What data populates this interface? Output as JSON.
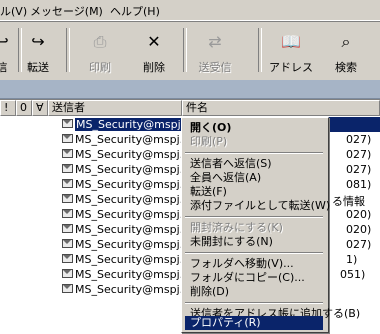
{
  "menubar": {
    "items": [
      "ル(V)",
      "メッセージ(M)",
      "ヘルプ(H)"
    ]
  },
  "toolbar": {
    "buttons": [
      {
        "label": "信",
        "icon": "reply-icon",
        "enabled": true
      },
      {
        "label": "転送",
        "icon": "forward-icon",
        "enabled": true
      },
      {
        "label": "印刷",
        "icon": "print-icon",
        "enabled": false
      },
      {
        "label": "削除",
        "icon": "delete-icon",
        "enabled": true
      },
      {
        "label": "送受信",
        "icon": "send-receive-icon",
        "enabled": false
      },
      {
        "label": "アドレス",
        "icon": "address-book-icon",
        "enabled": true
      },
      {
        "label": "検索",
        "icon": "find-icon",
        "enabled": true
      }
    ]
  },
  "list": {
    "columns": [
      "!",
      "0",
      "∀",
      "送信者",
      "件名"
    ],
    "rows": [
      {
        "sender": "MS_Security@mspj.co.jp",
        "subject_tail": "",
        "selected": true
      },
      {
        "sender": "MS_Security@mspj.co.jp",
        "subject_tail": "027)",
        "selected": false
      },
      {
        "sender": "MS_Security@mspj.co.jp",
        "subject_tail": "027)",
        "selected": false
      },
      {
        "sender": "MS_Security@mspj.co.jp",
        "subject_tail": "027)",
        "selected": false
      },
      {
        "sender": "MS_Security@mspj.co.jp",
        "subject_tail": "081)",
        "selected": false
      },
      {
        "sender": "MS_Security@mspj.co.jp",
        "subject_tail": "る情報",
        "selected": false
      },
      {
        "sender": "MS_Security@mspj.co.jp",
        "subject_tail": "020)",
        "selected": false
      },
      {
        "sender": "MS_Security@mspj.co.jp",
        "subject_tail": "020)",
        "selected": false
      },
      {
        "sender": "MS_Security@mspj.co.jp",
        "subject_tail": "027)",
        "selected": false
      },
      {
        "sender": "MS_Security@mspj.co.jp",
        "subject_tail": "1)",
        "selected": false
      },
      {
        "sender": "MS_Security@mspj.co.jp",
        "subject_tail": "051)",
        "selected": false
      },
      {
        "sender": "MS_Security@mspj.co.jp",
        "subject_tail": "",
        "selected": false
      }
    ]
  },
  "context_menu": {
    "items": [
      {
        "label": "開く(O)",
        "bold": true,
        "disabled": false
      },
      {
        "label": "印刷(P)",
        "disabled": true
      },
      {
        "sep": true
      },
      {
        "label": "送信者へ返信(S)",
        "disabled": false
      },
      {
        "label": "全員へ返信(A)",
        "disabled": false
      },
      {
        "label": "転送(F)",
        "disabled": false
      },
      {
        "label": "添付ファイルとして転送(W)",
        "disabled": false
      },
      {
        "sep": true
      },
      {
        "label": "開封済みにする(K)",
        "disabled": true
      },
      {
        "label": "未開封にする(N)",
        "disabled": false
      },
      {
        "sep": true
      },
      {
        "label": "フォルダへ移動(V)...",
        "disabled": false
      },
      {
        "label": "フォルダにコピー(C)...",
        "disabled": false
      },
      {
        "label": "削除(D)",
        "disabled": false
      },
      {
        "sep": true
      },
      {
        "label": "送信者をアドレス帳に追加する(B)",
        "disabled": false
      },
      {
        "sep": true
      },
      {
        "label": "プロパティ(R)",
        "disabled": false,
        "highlighted": true
      }
    ]
  }
}
